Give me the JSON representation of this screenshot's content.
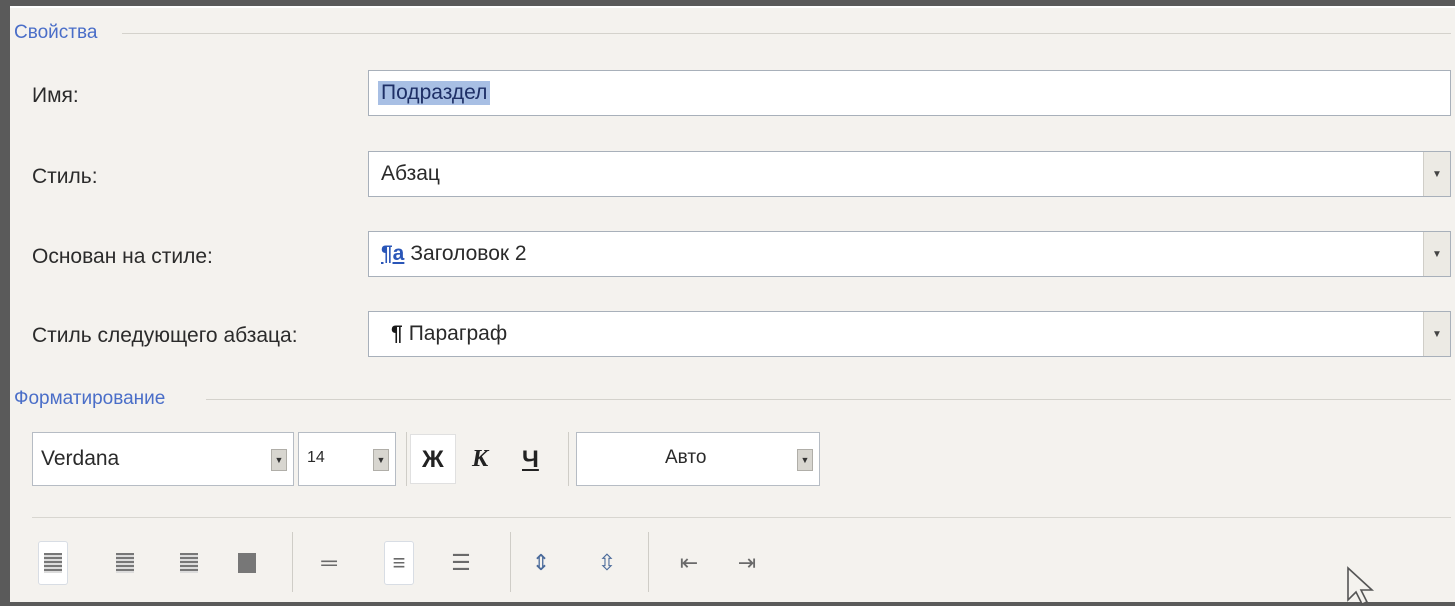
{
  "properties": {
    "title": "Свойства",
    "name_label": "Имя:",
    "name_value": "Подраздел",
    "style_label": "Стиль:",
    "style_value": "Абзац",
    "based_on_label": "Основан на стиле:",
    "based_on_icon": "¶a",
    "based_on_value": "Заголовок 2",
    "next_style_label": "Стиль следующего абзаца:",
    "next_style_icon": "¶",
    "next_style_value": "Параграф"
  },
  "formatting": {
    "title": "Форматирование",
    "font": "Verdana",
    "size": "14",
    "bold": "Ж",
    "italic": "К",
    "underline": "Ч",
    "color": "Авто"
  },
  "icons": {
    "dropdown": "chevron-down-icon",
    "align": [
      "align-left-icon",
      "align-center-icon",
      "align-right-icon",
      "align-justify-icon"
    ],
    "spacing": [
      "single-spacing-icon",
      "one-half-spacing-icon",
      "double-spacing-icon"
    ],
    "para_spacing": [
      "increase-paragraph-spacing-icon",
      "decrease-paragraph-spacing-icon"
    ],
    "indent": [
      "decrease-indent-icon",
      "increase-indent-icon"
    ],
    "cursor": "mouse-cursor-icon"
  },
  "colors": {
    "section_title": "#4a6ec8",
    "selection": "#a8bfe4",
    "dialog_bg": "#f4f2ee"
  }
}
